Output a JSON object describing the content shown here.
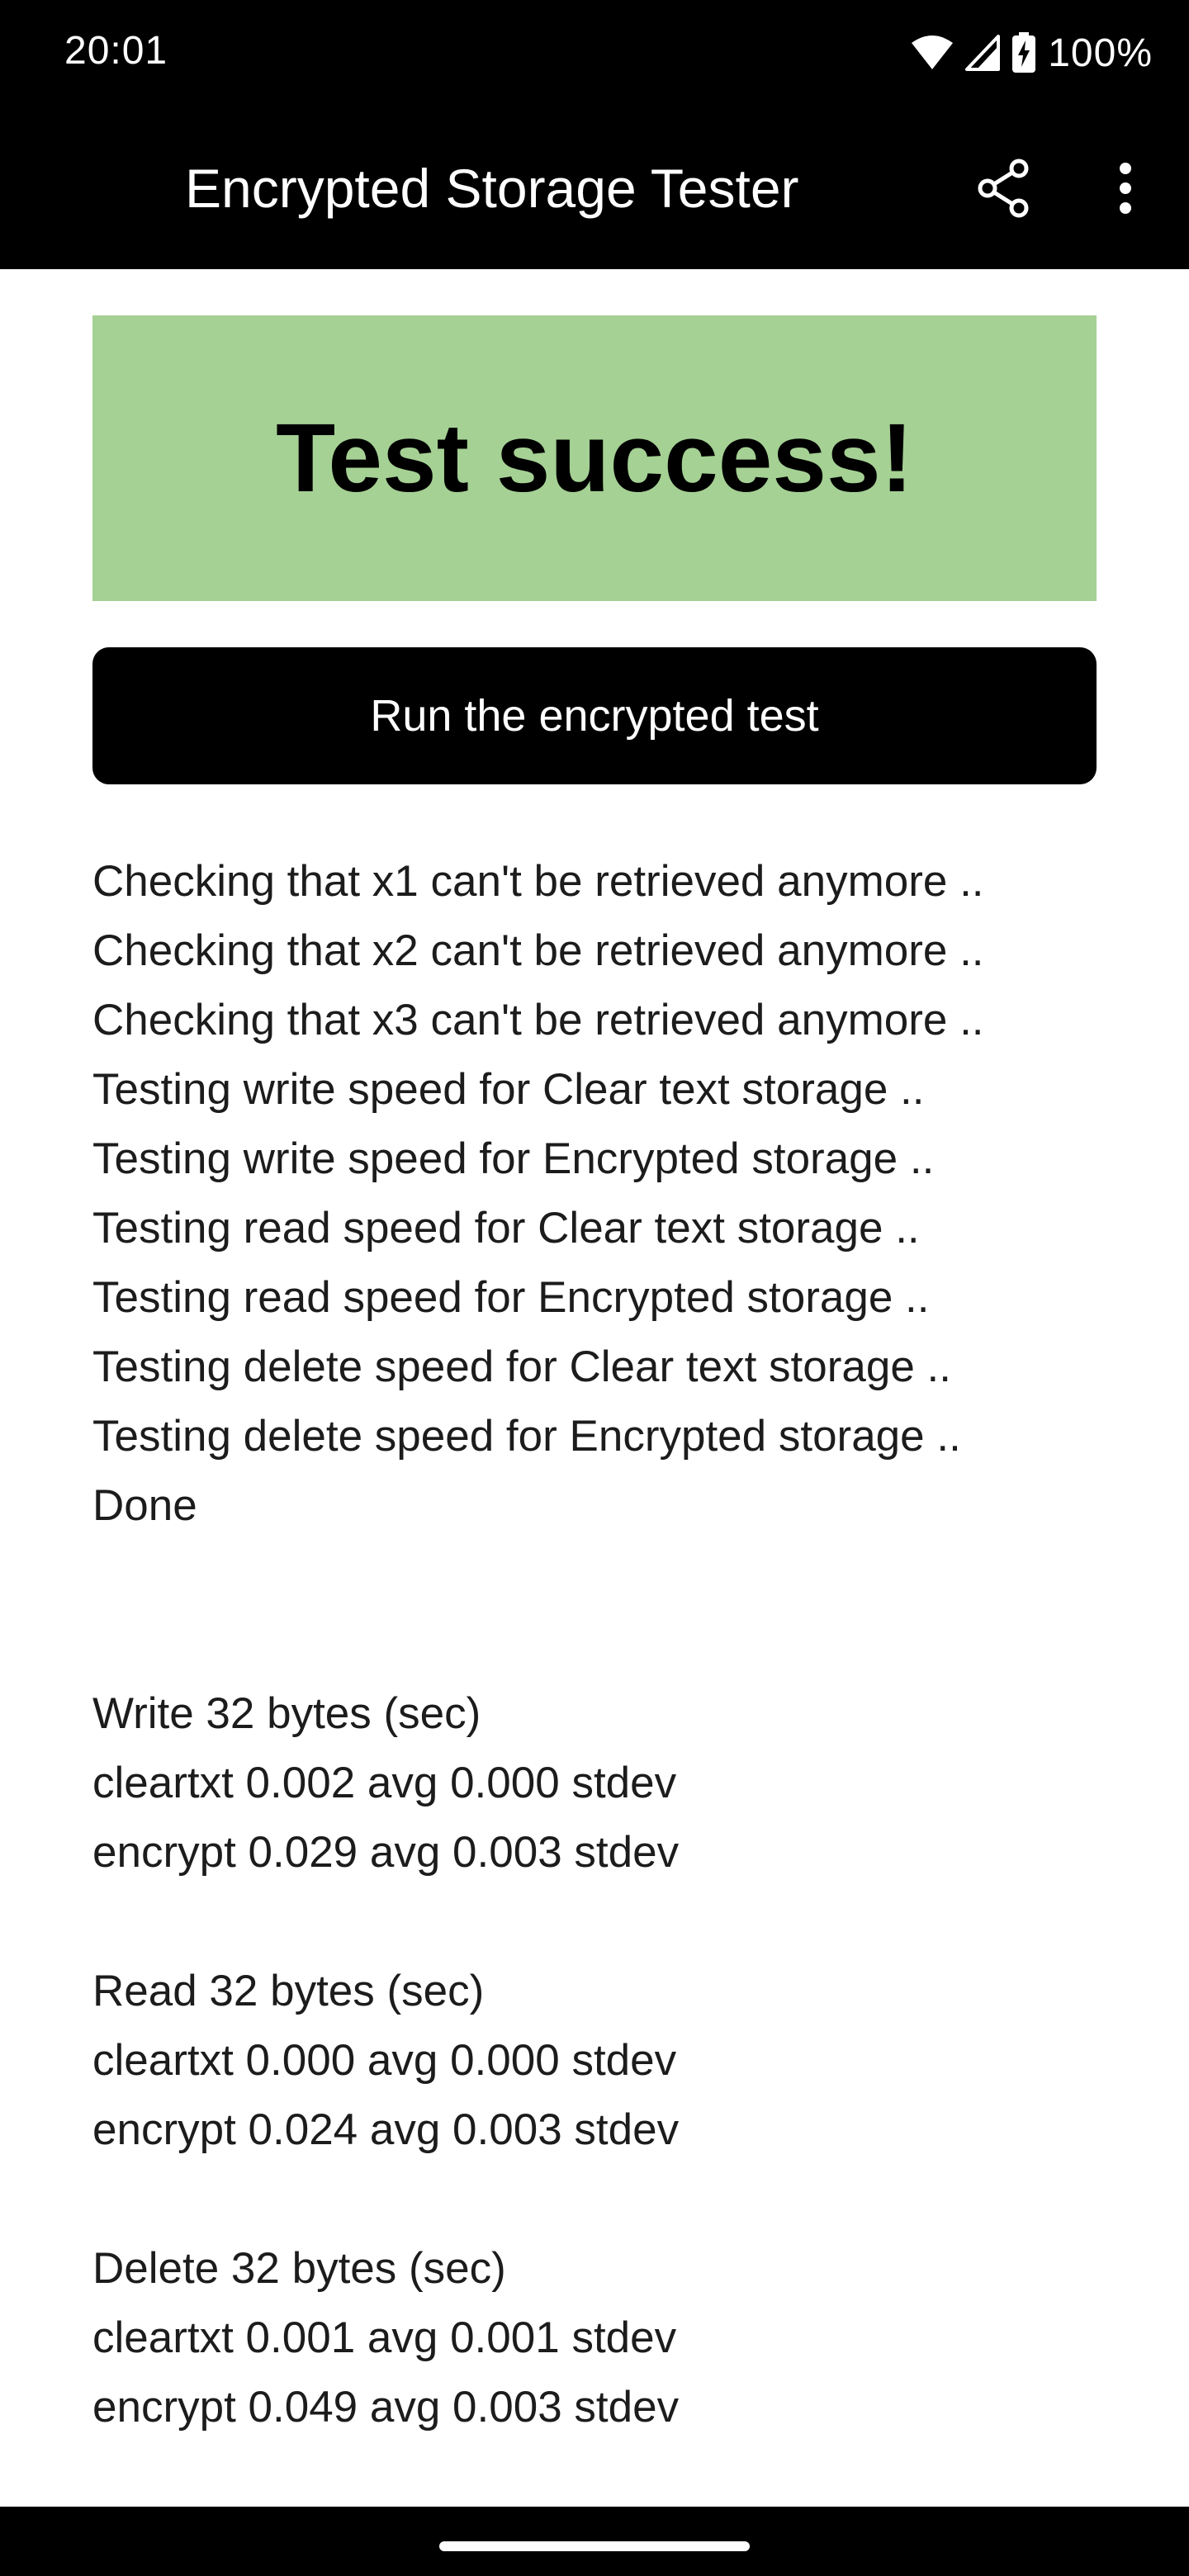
{
  "status_bar": {
    "time": "20:01",
    "battery_percent": "100%",
    "icons": [
      "wifi-icon",
      "cell-signal-icon",
      "battery-charging-icon"
    ]
  },
  "app_bar": {
    "title": "Encrypted Storage Tester",
    "actions": [
      "share-icon",
      "more-vert-icon"
    ]
  },
  "result_banner": {
    "text": "Test success!",
    "color": "#a5d194"
  },
  "run_button": {
    "label": "Run the encrypted test"
  },
  "log_lines": [
    "Checking that x1 can't be retrieved anymore ..",
    "Checking that x2 can't be retrieved anymore ..",
    "Checking that x3 can't be retrieved anymore ..",
    "Testing write speed for Clear text storage ..",
    "Testing write speed for Encrypted storage ..",
    "Testing read speed for Clear text storage ..",
    "Testing read speed for Encrypted storage ..",
    "Testing delete speed for Clear text storage ..",
    "Testing delete speed for Encrypted storage ..",
    "Done"
  ],
  "results": [
    {
      "heading": "Write 32 bytes (sec)",
      "cleartxt": "cleartxt 0.002 avg 0.000 stdev",
      "encrypt": "encrypt 0.029 avg 0.003 stdev"
    },
    {
      "heading": "Read 32 bytes (sec)",
      "cleartxt": "cleartxt 0.000 avg 0.000 stdev",
      "encrypt": "encrypt 0.024 avg 0.003 stdev"
    },
    {
      "heading": "Delete 32 bytes (sec)",
      "cleartxt": "cleartxt 0.001 avg 0.001 stdev",
      "encrypt": "encrypt 0.049 avg 0.003 stdev"
    }
  ]
}
